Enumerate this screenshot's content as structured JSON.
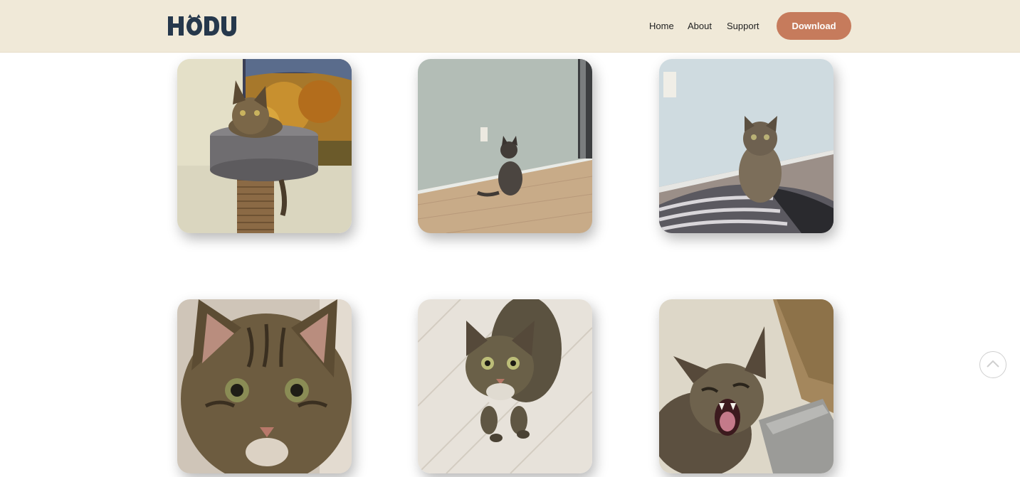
{
  "header": {
    "logo_text": "HODU",
    "nav": [
      {
        "label": "Home"
      },
      {
        "label": "About"
      },
      {
        "label": "Support"
      }
    ],
    "download_label": "Download"
  },
  "gallery": {
    "photos": [
      {
        "subject": "cat-on-scratching-post"
      },
      {
        "subject": "cat-facing-wall"
      },
      {
        "subject": "cat-sitting-on-blanket"
      },
      {
        "subject": "cat-face-closeup"
      },
      {
        "subject": "cat-looking-up"
      },
      {
        "subject": "cat-yawning"
      }
    ]
  },
  "scroll_top_icon": "chevron-up-icon",
  "colors": {
    "header_bg": "#f0e9d8",
    "accent": "#c67b5c",
    "logo": "#26384c"
  }
}
